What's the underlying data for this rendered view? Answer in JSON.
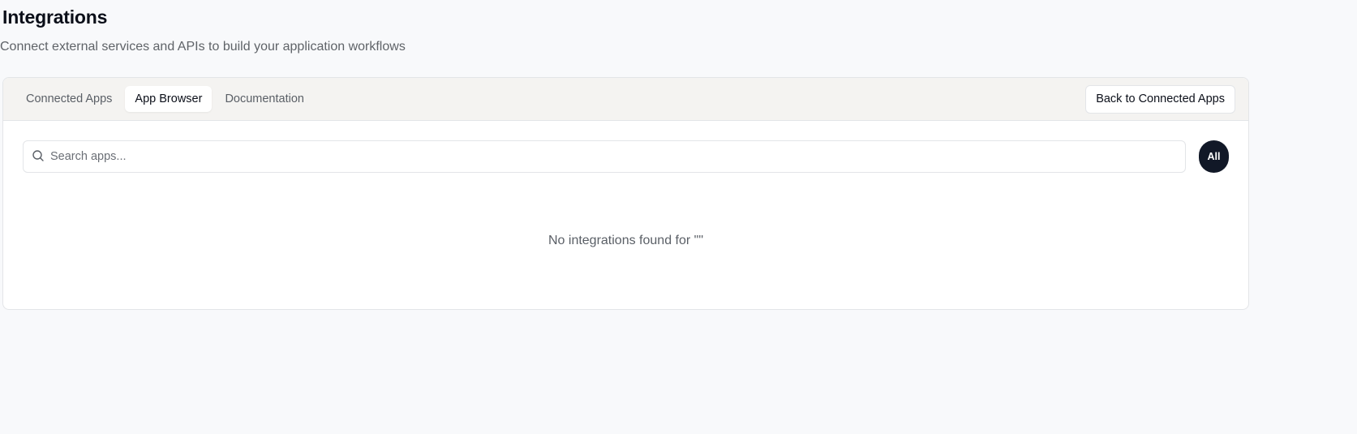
{
  "header": {
    "title": "Integrations",
    "subtitle": "Connect external services and APIs to build your application workflows"
  },
  "tabs": [
    {
      "label": "Connected Apps",
      "active": false
    },
    {
      "label": "App Browser",
      "active": true
    },
    {
      "label": "Documentation",
      "active": false
    }
  ],
  "back_button_label": "Back to Connected Apps",
  "search": {
    "placeholder": "Search apps...",
    "value": ""
  },
  "filter": {
    "selected_label": "All"
  },
  "empty_state": {
    "message": "No integrations found for \"\""
  },
  "colors": {
    "background": "#f8f9fb",
    "card_header": "#f4f3f1",
    "filter_active": "#111827"
  },
  "icons": {
    "search": "search-icon"
  }
}
